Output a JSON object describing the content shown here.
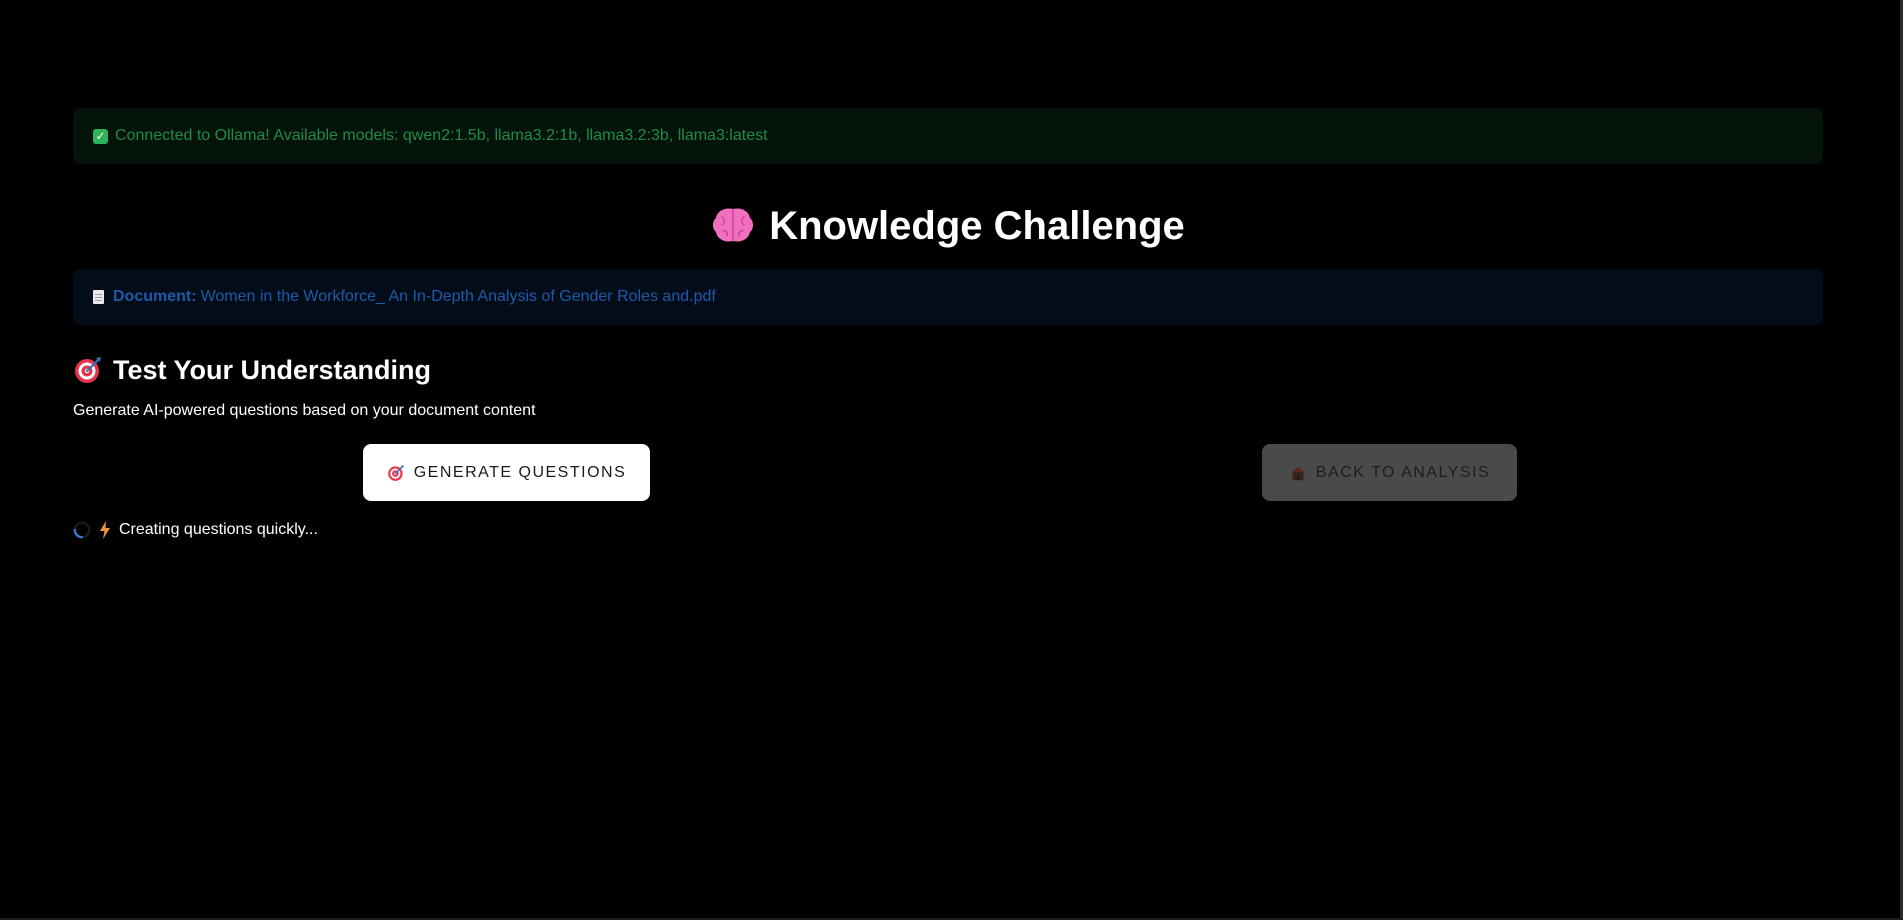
{
  "connection_alert": {
    "icon": "check-icon",
    "text": "Connected to Ollama! Available models: qwen2:1.5b, llama3.2:1b, llama3.2:3b, llama3:latest",
    "color": "#1f8a45"
  },
  "page": {
    "title_icon": "brain-icon",
    "title": "Knowledge Challenge"
  },
  "document_info": {
    "icon": "document-icon",
    "label": "Document:",
    "filename": "Women in the Workforce_ An In-Depth Analysis of Gender Roles and.pdf",
    "color": "#1d5aa8"
  },
  "section": {
    "icon": "target-icon",
    "title": "Test Your Understanding",
    "subtitle": "Generate AI-powered questions based on your document content"
  },
  "actions": {
    "generate_icon": "target-icon",
    "generate_label": "GENERATE QUESTIONS",
    "back_icon": "house-icon",
    "back_label": "BACK TO ANALYSIS"
  },
  "status": {
    "spinner_icon": "spinner-icon",
    "bolt_icon": "lightning-icon",
    "text": "Creating questions quickly..."
  },
  "theme": {
    "background": "#000000",
    "success_bg": "#04140a",
    "info_bg": "#030d1a",
    "primary_button_bg": "#ffffff",
    "disabled_button_bg": "#4a4a4a"
  }
}
